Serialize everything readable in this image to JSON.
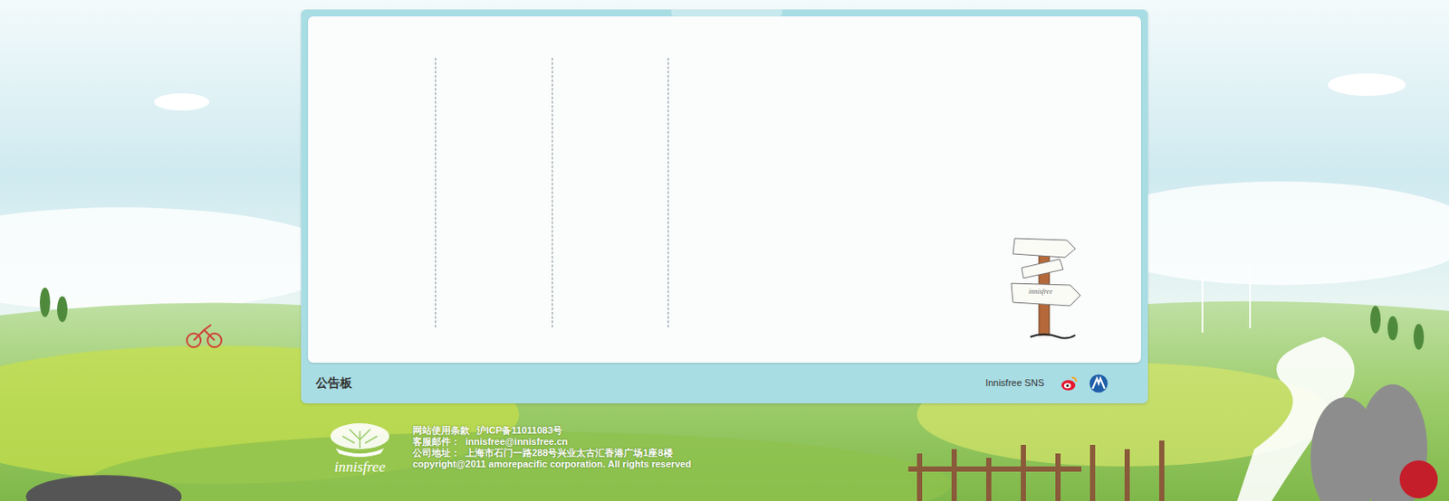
{
  "notice_board": {
    "title": "公告板",
    "sns_label": "Innisfree SNS",
    "columns": 4,
    "signpost_text": "innisfree"
  },
  "footer": {
    "logo_text": "innisfree",
    "links": [
      "网站使用条款",
      "沪ICP备11011083号"
    ],
    "email_label": "客服邮件：",
    "email": "innisfree@innisfree.cn",
    "address_label": "公司地址：",
    "address": "上海市石门一路288号兴业太古汇香港广场1座8楼",
    "copyright": "copyright@2011 amorepacific corporation. All rights reserved"
  }
}
